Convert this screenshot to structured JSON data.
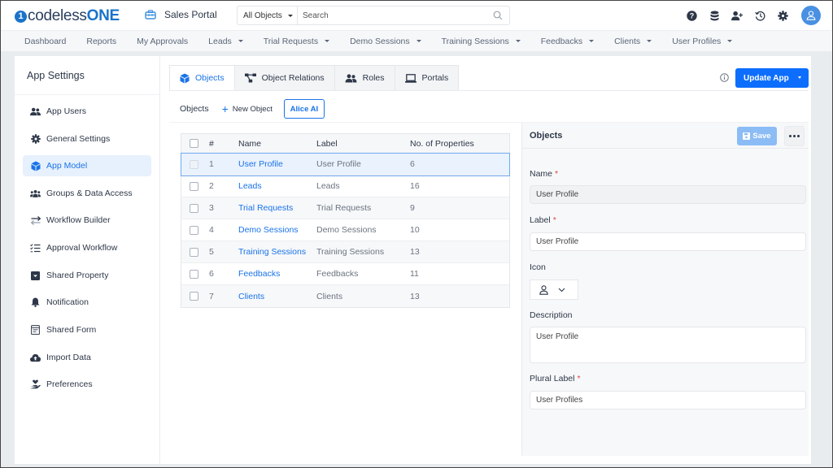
{
  "app": {
    "logo_text_main": "codeless",
    "logo_text_accent": "ONE",
    "portal_name": "Sales Portal"
  },
  "search": {
    "scope": "All Objects",
    "placeholder": "Search"
  },
  "top_icons": [
    "help-icon",
    "database-icon",
    "add-user-icon",
    "history-icon",
    "settings-icon",
    "user-avatar"
  ],
  "nav": [
    {
      "label": "Dashboard",
      "dropdown": false
    },
    {
      "label": "Reports",
      "dropdown": false
    },
    {
      "label": "My Approvals",
      "dropdown": false
    },
    {
      "label": "Leads",
      "dropdown": true
    },
    {
      "label": "Trial Requests",
      "dropdown": true
    },
    {
      "label": "Demo Sessions",
      "dropdown": true
    },
    {
      "label": "Training Sessions",
      "dropdown": true
    },
    {
      "label": "Feedbacks",
      "dropdown": true
    },
    {
      "label": "Clients",
      "dropdown": true
    },
    {
      "label": "User Profiles",
      "dropdown": true
    }
  ],
  "sidebar": {
    "title": "App Settings",
    "items": [
      {
        "label": "App Users",
        "icon": "users-icon"
      },
      {
        "label": "General Settings",
        "icon": "gear-icon"
      },
      {
        "label": "App Model",
        "icon": "cube-icon",
        "active": true
      },
      {
        "label": "Groups & Data Access",
        "icon": "group-icon"
      },
      {
        "label": "Workflow Builder",
        "icon": "exchange-icon"
      },
      {
        "label": "Approval Workflow",
        "icon": "checklist-icon"
      },
      {
        "label": "Shared Property",
        "icon": "inbox-icon"
      },
      {
        "label": "Notification",
        "icon": "bell-icon"
      },
      {
        "label": "Shared Form",
        "icon": "form-icon"
      },
      {
        "label": "Import Data",
        "icon": "cloud-upload-icon"
      },
      {
        "label": "Preferences",
        "icon": "hand-heart-icon"
      }
    ]
  },
  "tabs": [
    {
      "label": "Objects",
      "icon": "cube-icon",
      "active": true
    },
    {
      "label": "Object Relations",
      "icon": "relations-icon"
    },
    {
      "label": "Roles",
      "icon": "users-icon"
    },
    {
      "label": "Portals",
      "icon": "laptop-icon"
    }
  ],
  "toolbar": {
    "update_label": "Update App",
    "section_title": "Objects",
    "new_object_label": "New Object",
    "alice_label": "Alice AI"
  },
  "table": {
    "columns": [
      "#",
      "Name",
      "Label",
      "No. of Properties"
    ],
    "rows": [
      {
        "num": "1",
        "name": "User Profile",
        "label": "User Profile",
        "props": "6",
        "selected": true
      },
      {
        "num": "2",
        "name": "Leads",
        "label": "Leads",
        "props": "16"
      },
      {
        "num": "3",
        "name": "Trial Requests",
        "label": "Trial Requests",
        "props": "9"
      },
      {
        "num": "4",
        "name": "Demo Sessions",
        "label": "Demo Sessions",
        "props": "10"
      },
      {
        "num": "5",
        "name": "Training Sessions",
        "label": "Training Sessions",
        "props": "13"
      },
      {
        "num": "6",
        "name": "Feedbacks",
        "label": "Feedbacks",
        "props": "11"
      },
      {
        "num": "7",
        "name": "Clients",
        "label": "Clients",
        "props": "13"
      }
    ]
  },
  "panel": {
    "title": "Objects",
    "save_label": "Save",
    "fields": {
      "name_label": "Name",
      "name_value": "User Profile",
      "label_label": "Label",
      "label_value": "User Profile",
      "icon_label": "Icon",
      "icon_value": "user-icon",
      "description_label": "Description",
      "description_value": "User Profile",
      "plural_label": "Plural Label",
      "plural_value": "User Profiles",
      "required_mark": "*"
    }
  },
  "colors": {
    "accent": "#1a73e8",
    "primary_button": "#0d6efd",
    "save_disabled": "#8cbcf5",
    "required": "#e04545"
  }
}
